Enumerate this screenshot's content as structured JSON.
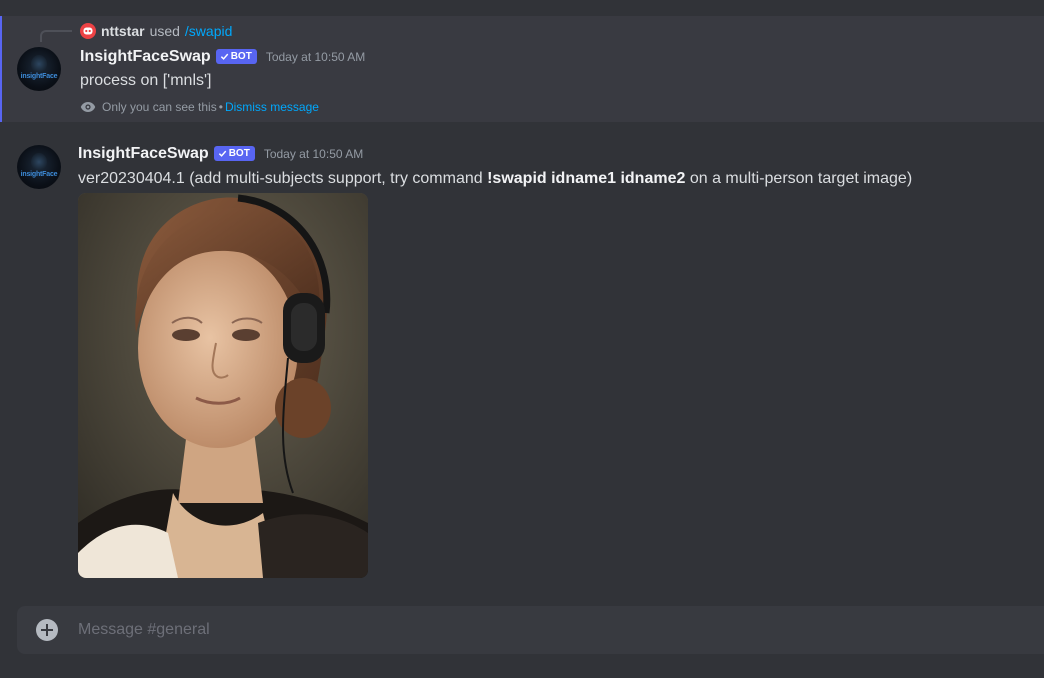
{
  "ephemeral_message": {
    "reply": {
      "user": "nttstar",
      "used_text": "used",
      "command": "/swapid"
    },
    "author": "InsightFaceSwap",
    "bot_tag": "BOT",
    "timestamp": "Today at 10:50 AM",
    "text": "process on ['mnls']",
    "note": "Only you can see this",
    "separator": "•",
    "dismiss_label": "Dismiss message"
  },
  "message": {
    "author": "InsightFaceSwap",
    "bot_tag": "BOT",
    "timestamp": "Today at 10:50 AM",
    "text_before": "ver20230404.1 (add multi-subjects support, try command ",
    "text_bold": "!swapid idname1 idname2",
    "text_after": " on a multi-person target image)",
    "avatar_text": "insightFace"
  },
  "composer": {
    "placeholder": "Message #general"
  },
  "colors": {
    "background": "#313338",
    "highlight": "#393a41",
    "accent": "#5865f2",
    "link": "#00a8fc",
    "danger": "#ed4245"
  },
  "icons": {
    "command": "command-app-icon",
    "eye": "eye-icon",
    "check": "check-icon",
    "plus": "plus-circle-icon"
  }
}
